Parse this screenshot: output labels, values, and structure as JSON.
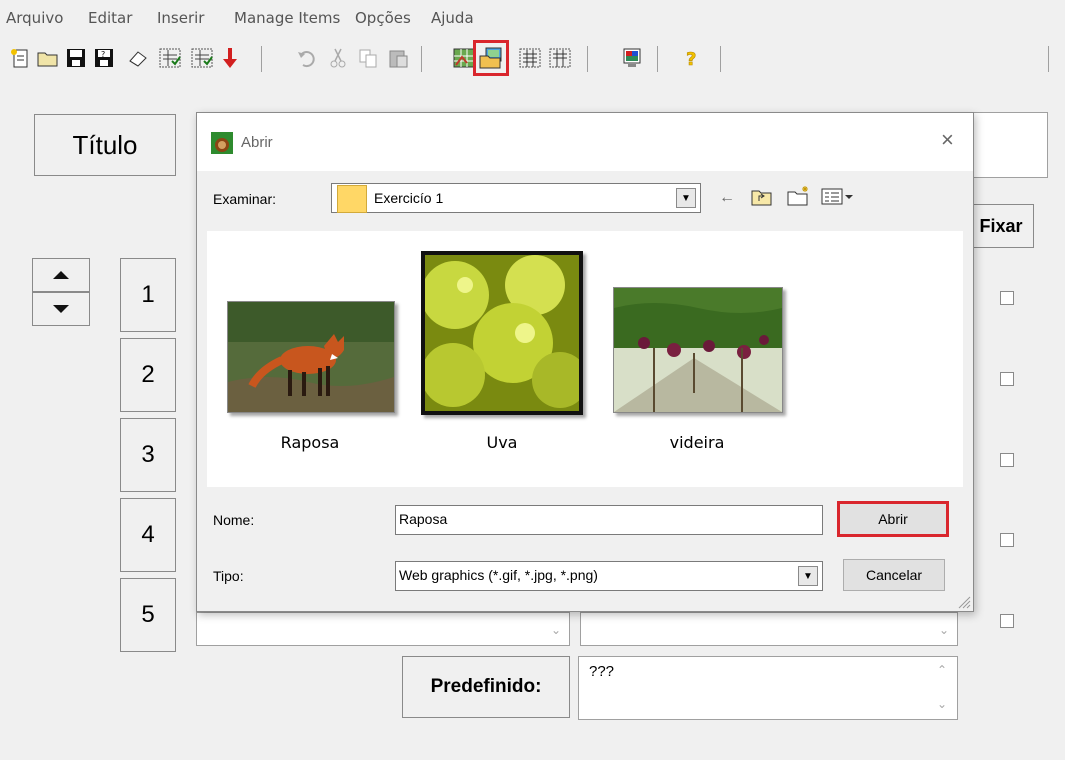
{
  "menu": [
    "Arquivo",
    "Editar",
    "Inserir",
    "Manage Items",
    "Opções",
    "Ajuda"
  ],
  "toolbar": {
    "icons": [
      "new-file-icon",
      "open-folder-icon",
      "save-icon",
      "save-as-icon",
      "eraser-icon",
      "check-web-icon",
      "check-web-2-icon",
      "insert-down-icon",
      "undo-icon",
      "cut-icon",
      "copy-icon",
      "paste-icon",
      "web-image-icon",
      "open-image-icon",
      "web-grid-icon",
      "web-grid-2-icon",
      "image-monitor-icon",
      "help-icon"
    ],
    "highlighted": "open-image-icon"
  },
  "form": {
    "title_label": "Título",
    "fix_label": "Fixar",
    "rows": [
      "1",
      "2",
      "3",
      "4",
      "5"
    ],
    "preset_label": "Predefinido:",
    "preset_value": "???"
  },
  "dialog": {
    "title": "Abrir",
    "browse_label": "Examinar:",
    "folder": "Exercicío 1",
    "files": [
      {
        "name": "Raposa",
        "icon": "fox-image"
      },
      {
        "name": "Uva",
        "icon": "grapes-image"
      },
      {
        "name": "videira",
        "icon": "vineyard-image"
      }
    ],
    "name_label": "Nome:",
    "name_value": "Raposa",
    "type_label": "Tipo:",
    "type_value": "Web graphics (*.gif, *.jpg, *.png)",
    "open_button": "Abrir",
    "cancel_button": "Cancelar",
    "highlight_color": "#d9262d"
  }
}
